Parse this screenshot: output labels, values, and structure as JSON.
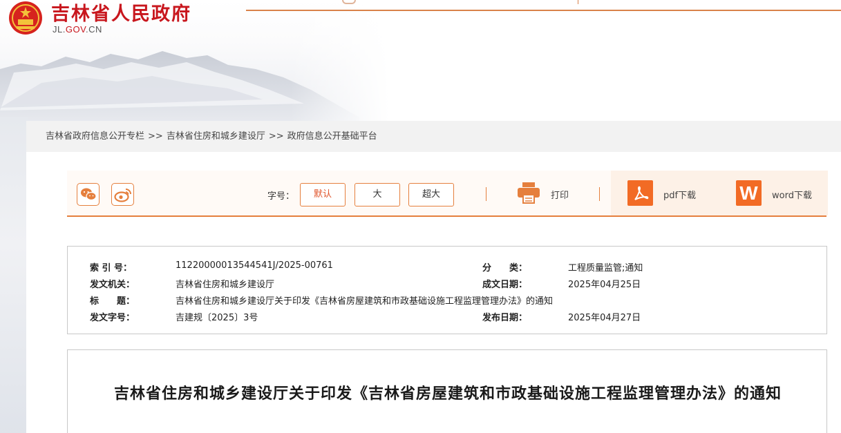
{
  "site": {
    "title": "吉林省人民政府",
    "domain_pre": "JL.",
    "domain_mid": "GOV",
    "domain_post": ".CN"
  },
  "breadcrumb": {
    "items": [
      "吉林省政府信息公开专栏",
      "吉林省住房和城乡建设厅",
      "政府信息公开基础平台"
    ],
    "separator": ">>"
  },
  "toolbar": {
    "share_icons": [
      "wechat-icon",
      "weibo-icon"
    ],
    "font_label": "字号：",
    "font_options": [
      "默认",
      "大",
      "超大"
    ],
    "font_selected": "默认",
    "print_label": "打印",
    "pdf_label": "pdf下载",
    "word_label": "word下载",
    "word_glyph": "W"
  },
  "meta": {
    "index_label": "索 引 号：",
    "index_value": "11220000013544541J/2025-00761",
    "category_label": "分　　类：",
    "category_value": "工程质量监管;通知",
    "issuer_label": "发文机关：",
    "issuer_value": "吉林省住房和城乡建设厅",
    "date_written_label": "成文日期：",
    "date_written_value": "2025年04月25日",
    "title_label": "标　　题：",
    "title_value": "吉林省住房和城乡建设厅关于印发《吉林省房屋建筑和市政基础设施工程监理管理办法》的通知",
    "docno_label": "发文字号：",
    "docno_value": "吉建规〔2025〕3号",
    "publish_label": "发布日期：",
    "publish_value": "2025年04月27日"
  },
  "article": {
    "title": "吉林省住房和城乡建设厅关于印发《吉林省房屋建筑和市政基础设施工程监理管理办法》的通知"
  },
  "colors": {
    "brand_red": "#c8161d",
    "accent_orange": "#e57f3d",
    "download_orange": "#f26b25"
  }
}
